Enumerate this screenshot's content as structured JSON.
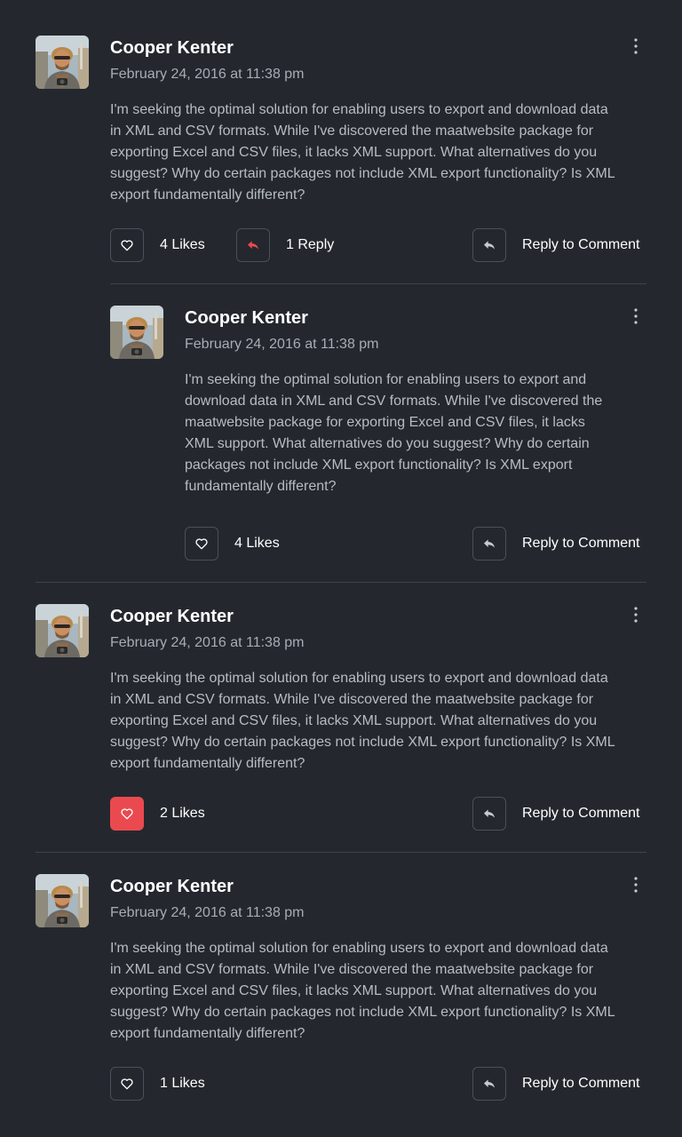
{
  "comments": [
    {
      "author": "Cooper Kenter",
      "date": "February 24, 2016 at 11:38 pm",
      "text": "I'm seeking the optimal solution for enabling users to export and download data in XML and CSV formats. While I've discovered the maatwebsite package for exporting Excel and CSV files, it lacks XML support. What alternatives do you suggest? Why do certain packages not include XML export functionality? Is XML export fundamentally different?",
      "likes_label": "4 Likes",
      "liked": false,
      "replies_label": "1 Reply",
      "reply_label": "Reply to Comment",
      "reply": {
        "author": "Cooper Kenter",
        "date": "February 24, 2016 at 11:38 pm",
        "text": "I'm seeking the optimal solution for enabling users to export and download data in XML and CSV formats. While I've discovered the maatwebsite package for exporting Excel and CSV files, it lacks XML support. What alternatives do you suggest? Why do certain packages not include XML export functionality? Is XML export fundamentally different?",
        "likes_label": "4 Likes",
        "liked": false,
        "reply_label": "Reply to Comment"
      }
    },
    {
      "author": "Cooper Kenter",
      "date": "February 24, 2016 at 11:38 pm",
      "text": "I'm seeking the optimal solution for enabling users to export and download data in XML and CSV formats. While I've discovered the maatwebsite package for exporting Excel and CSV files, it lacks XML support. What alternatives do you suggest? Why do certain packages not include XML export functionality? Is XML export fundamentally different?",
      "likes_label": "2 Likes",
      "liked": true,
      "reply_label": "Reply to Comment"
    },
    {
      "author": "Cooper Kenter",
      "date": "February 24, 2016 at 11:38 pm",
      "text": "I'm seeking the optimal solution for enabling users to export and download data in XML and CSV formats. While I've discovered the maatwebsite package for exporting Excel and CSV files, it lacks XML support. What alternatives do you suggest? Why do certain packages not include XML export functionality? Is XML export fundamentally different?",
      "likes_label": "1 Likes",
      "liked": false,
      "reply_label": "Reply to Comment"
    }
  ],
  "colors": {
    "background": "#24282e",
    "accent_red": "#ea4a4f",
    "border": "#4a5058",
    "muted_text": "#a7adb5"
  },
  "icons": {
    "like": "heart-icon",
    "replies": "reply-arrow-icon",
    "reply": "reply-arrow-icon",
    "menu": "more-vertical-icon",
    "avatar": "user-photo"
  }
}
